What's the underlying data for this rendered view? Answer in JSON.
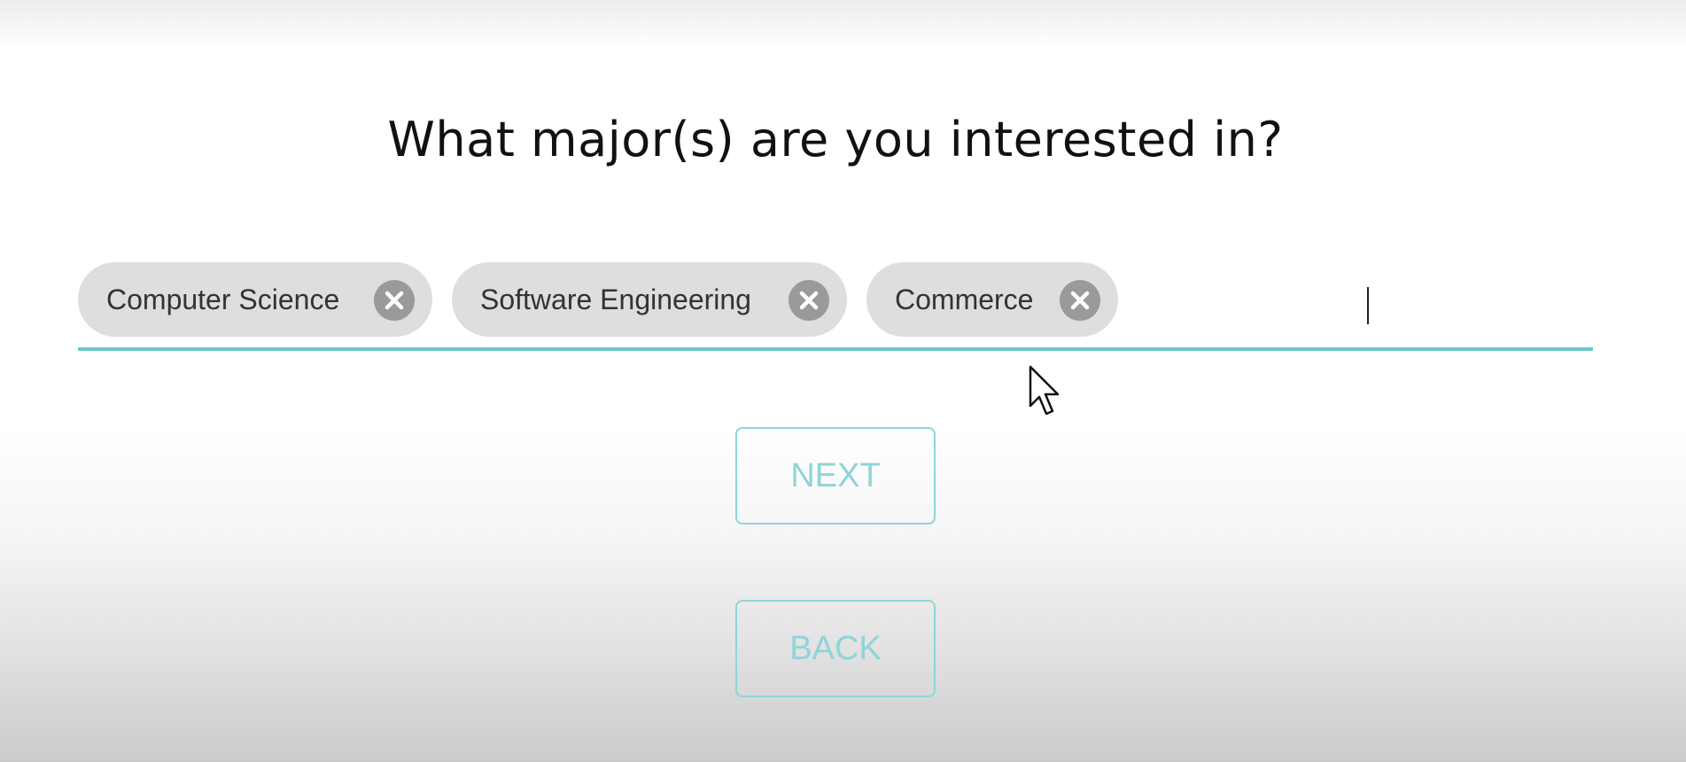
{
  "question": "What major(s) are you interested in?",
  "majors_field": {
    "chips": [
      {
        "label": "Computer Science"
      },
      {
        "label": "Software Engineering"
      },
      {
        "label": "Commerce"
      }
    ],
    "input_value": ""
  },
  "buttons": {
    "next_label": "NEXT",
    "back_label": "BACK"
  },
  "colors": {
    "accent": "#6fc6cb",
    "button_text": "#8fd4d8",
    "chip_bg": "#dedede",
    "chip_remove_bg": "#9a9a9a"
  },
  "icons": {
    "chip_remove": "close-circle-icon",
    "pointer": "mouse-cursor-icon"
  }
}
